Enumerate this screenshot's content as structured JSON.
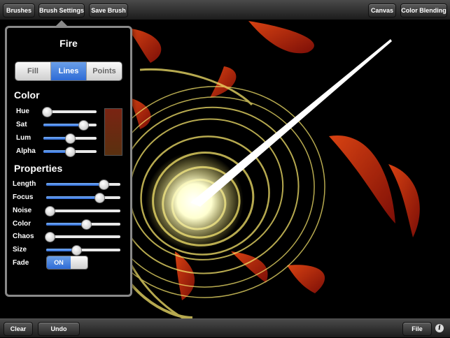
{
  "toolbar": {
    "brushes": "Brushes",
    "brush_settings": "Brush Settings",
    "save_brush": "Save Brush",
    "canvas": "Canvas",
    "color_blending": "Color Blending"
  },
  "bottom": {
    "clear": "Clear",
    "undo": "Undo",
    "file": "File",
    "info_icon": "i"
  },
  "panel": {
    "title": "Fire",
    "modes": [
      "Fill",
      "Lines",
      "Points"
    ],
    "selected_mode": "Lines",
    "color_heading": "Color",
    "color_sliders": [
      {
        "label": "Hue",
        "value": 0.07
      },
      {
        "label": "Sat",
        "value": 0.75
      },
      {
        "label": "Lum",
        "value": 0.5
      },
      {
        "label": "Alpha",
        "value": 0.5
      }
    ],
    "swatch_color": "#7a2412",
    "properties_heading": "Properties",
    "property_sliders": [
      {
        "label": "Length",
        "value": 0.77
      },
      {
        "label": "Focus",
        "value": 0.72
      },
      {
        "label": "Noise",
        "value": 0.05
      },
      {
        "label": "Color",
        "value": 0.54
      },
      {
        "label": "Chaos",
        "value": 0.05
      },
      {
        "label": "Size",
        "value": 0.41
      }
    ],
    "fade_label": "Fade",
    "fade_state": "ON"
  },
  "colors": {
    "accent": "#2e6bd6",
    "fire_red": "#d3250f",
    "fire_yellow": "#f5e35a"
  }
}
